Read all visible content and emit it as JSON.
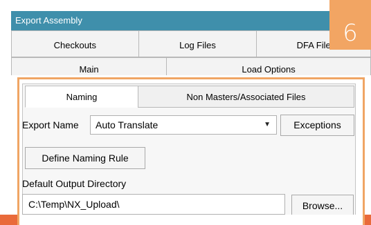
{
  "window": {
    "title": "Export Assembly"
  },
  "callout": {
    "number": "6"
  },
  "tabs_row1": [
    "Checkouts",
    "Log Files",
    "DFA File"
  ],
  "tabs_row2": [
    "Main",
    "Load Options"
  ],
  "inner_tabs": {
    "active": "Naming",
    "inactive": "Non Masters/Associated Files"
  },
  "export_name": {
    "label": "Export Name",
    "value": "Auto Translate",
    "exceptions_label": "Exceptions"
  },
  "define_naming_rule_label": "Define Naming Rule",
  "output_dir": {
    "label": "Default Output Directory",
    "value": "C:\\Temp\\NX_Upload\\",
    "browse_label": "Browse..."
  },
  "colors": {
    "title_bar": "#3f8fab",
    "highlight": "#f0a564",
    "callout": "#f2a563",
    "bottom_bar": "#e96a3a"
  }
}
